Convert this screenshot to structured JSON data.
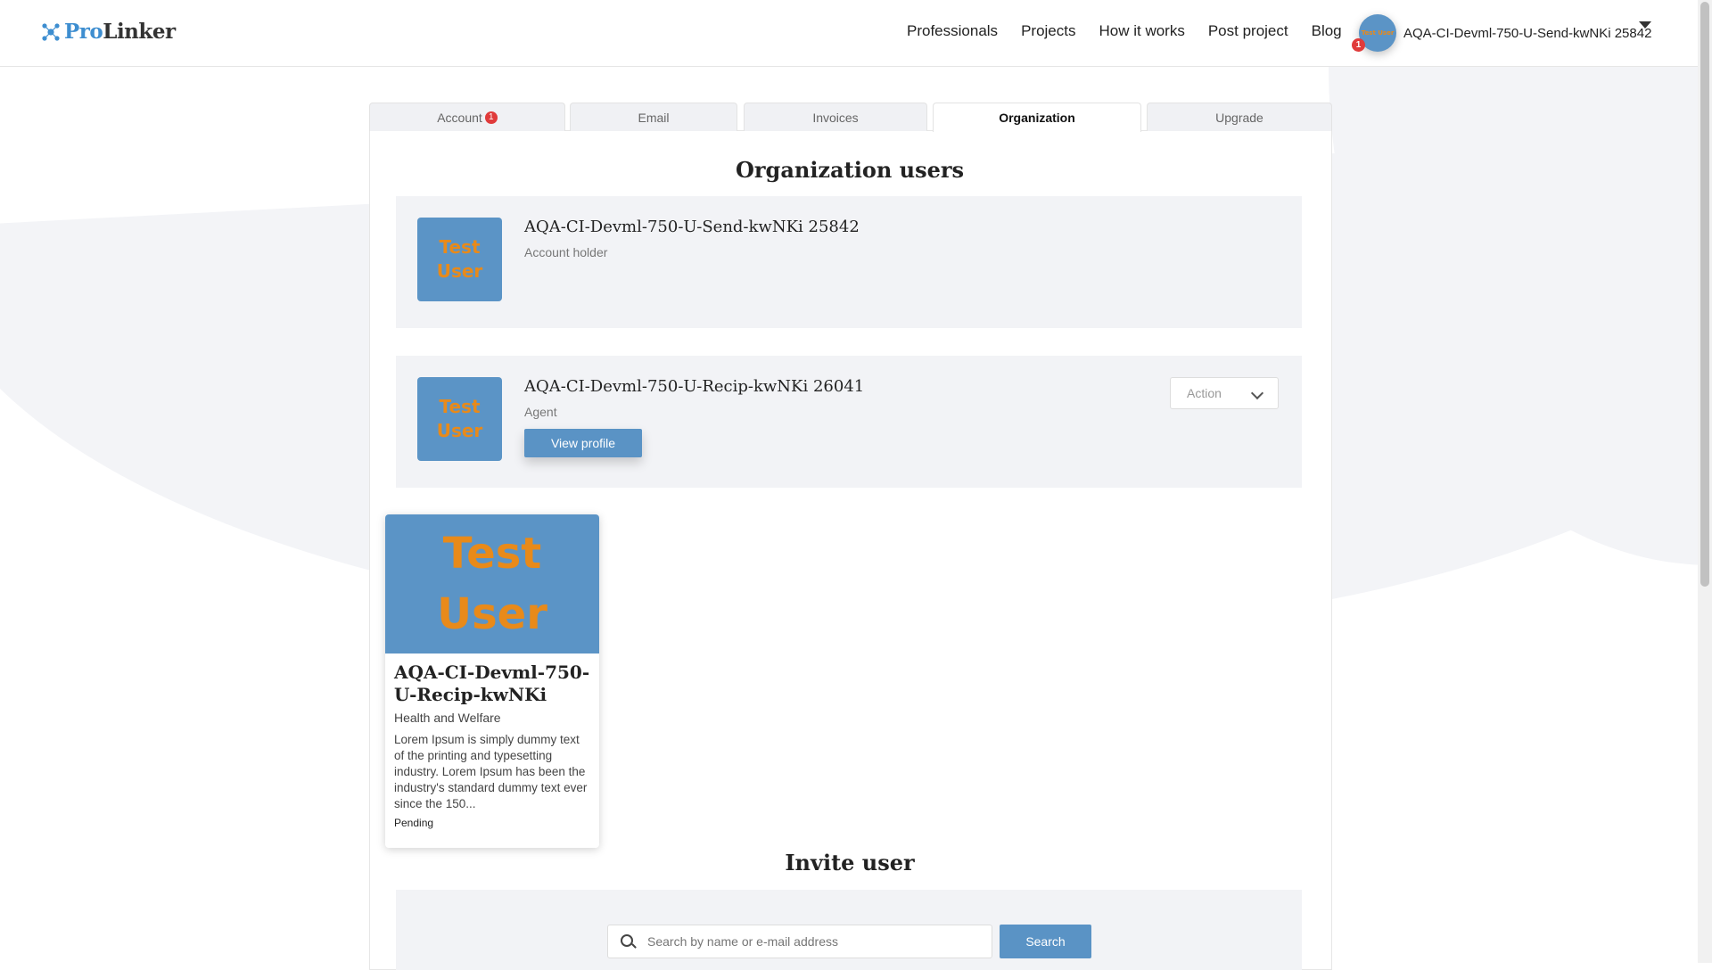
{
  "brand": {
    "pro": "Pro",
    "linker": "Linker"
  },
  "nav": {
    "items": [
      "Professionals",
      "Projects",
      "How it works",
      "Post project",
      "Blog"
    ]
  },
  "header_user": {
    "name": "AQA-CI-Devml-750-U-Send-kwNKi 25842",
    "notification_count": "1",
    "avatar_text": "Test User"
  },
  "tabs": [
    {
      "label": "Account",
      "badge": "1"
    },
    {
      "label": "Email"
    },
    {
      "label": "Invoices"
    },
    {
      "label": "Organization",
      "active": true
    },
    {
      "label": "Upgrade"
    }
  ],
  "org": {
    "title": "Organization users",
    "users": [
      {
        "avatar_line1": "Test",
        "avatar_line2": "User",
        "name": "AQA-CI-Devml-750-U-Send-kwNKi 25842",
        "role": "Account holder"
      },
      {
        "avatar_line1": "Test",
        "avatar_line2": "User",
        "name": "AQA-CI-Devml-750-U-Recip-kwNKi 26041",
        "role": "Agent",
        "view_profile_label": "View profile",
        "action_placeholder": "Action"
      }
    ]
  },
  "pending_card": {
    "image_line1": "Test",
    "image_line2": "User",
    "name": "AQA-CI-Devml-750-U-Recip-kwNKi",
    "category": "Health and Welfare",
    "description": "Lorem Ipsum is simply dummy text of the printing and typesetting industry. Lorem Ipsum has been the industry's standard dummy text ever since the 150...",
    "status": "Pending"
  },
  "invite": {
    "title": "Invite user",
    "search_placeholder": "Search by name or e-mail address",
    "search_button": "Search"
  },
  "colors": {
    "accent": "#5a93c5",
    "avatar_bg": "#5b94c6",
    "avatar_text": "#e88a1a",
    "badge": "#e03b3b"
  }
}
